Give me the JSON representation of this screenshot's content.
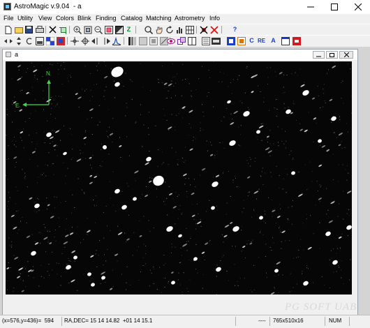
{
  "window": {
    "title": "AstroMagic v.9.04  - a"
  },
  "menu": [
    "File",
    "Utility",
    "View",
    "Colors",
    "Blink",
    "Finding",
    "Catalog",
    "Matching",
    "Astrometry",
    "Info"
  ],
  "toolbar": {
    "help_glyph": "?",
    "zoom_glyph": "Z",
    "tool_c": "C",
    "tool_re": "RE",
    "tool_a": "A"
  },
  "child": {
    "title": "a"
  },
  "compass": {
    "north": "N",
    "east": "E"
  },
  "watermark": "PG  SOFT UAB",
  "status": {
    "pixel": "(x=576,y=436)=  594",
    "radec": "RA,DEC= 15 14 14.82  +01 14 15.1",
    "blank": "----",
    "size": "765x510x16",
    "num": "NUM"
  },
  "colors": {
    "compass": "#3ddc3d",
    "title_bar": "#ffffff",
    "image_bg": "#060606"
  }
}
